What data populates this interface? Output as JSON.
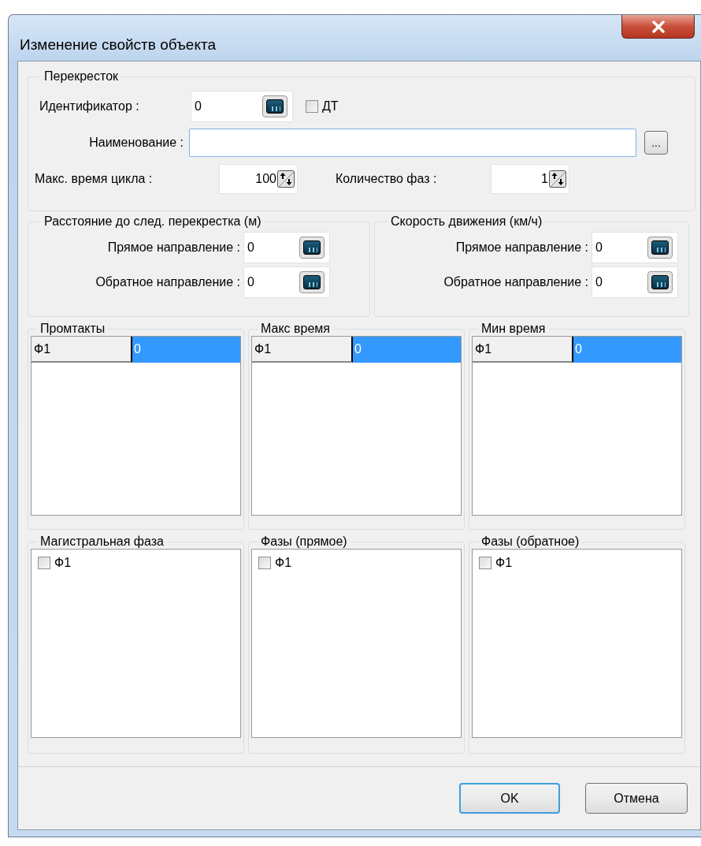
{
  "window": {
    "title": "Изменение свойств объекта"
  },
  "intersection": {
    "title": "Перекресток",
    "id": {
      "label": "Идентификатор :",
      "value": "0"
    },
    "dt": {
      "label": "ДТ",
      "checked": false
    },
    "name": {
      "label": "Наименование :",
      "browse": "..."
    },
    "max_cycle": {
      "label": "Макс. время цикла :",
      "value": "100"
    },
    "phase_count": {
      "label": "Количество фаз :",
      "value": "1"
    }
  },
  "distance": {
    "title": "Расстояние до след. перекрестка (м)",
    "fields": [
      {
        "label": "Прямое направление :",
        "value": "0"
      },
      {
        "label": "Обратное направление :",
        "value": "0"
      }
    ]
  },
  "speed": {
    "title": "Скорость движения (км/ч)",
    "fields": [
      {
        "label": "Прямое направление :",
        "value": "0"
      },
      {
        "label": "Обратное направление :",
        "value": "0"
      }
    ]
  },
  "tables": [
    {
      "title": "Промтакты",
      "rows": [
        {
          "name": "Ф1",
          "value": "0",
          "selected": true
        }
      ]
    },
    {
      "title": "Макс время",
      "rows": [
        {
          "name": "Ф1",
          "value": "0",
          "selected": true
        }
      ]
    },
    {
      "title": "Мин время",
      "rows": [
        {
          "name": "Ф1",
          "value": "0",
          "selected": true
        }
      ]
    }
  ],
  "checklists": [
    {
      "title": "Магистральная фаза",
      "items": [
        {
          "label": "Ф1",
          "checked": false
        }
      ]
    },
    {
      "title": "Фазы (прямое)",
      "items": [
        {
          "label": "Ф1",
          "checked": false
        }
      ]
    },
    {
      "title": "Фазы (обратное)",
      "items": [
        {
          "label": "Ф1",
          "checked": false
        }
      ]
    }
  ],
  "buttons": [
    {
      "label": "OK",
      "default": true
    },
    {
      "label": "Отмена",
      "default": false
    }
  ]
}
